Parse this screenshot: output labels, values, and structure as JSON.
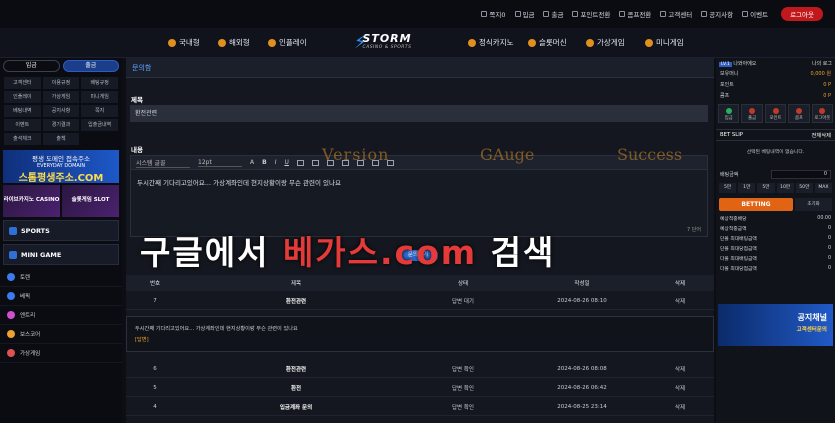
{
  "topbar": {
    "links": [
      "쪽지0",
      "입금",
      "출금",
      "포인트전환",
      "콤프전환",
      "고객센터",
      "공지사항",
      "이벤트"
    ],
    "logout": "로그아웃"
  },
  "nav": {
    "left": [
      "국내형",
      "해외형",
      "인플레이"
    ],
    "right": [
      "정식카지노",
      "슬롯머신",
      "가상게임",
      "미니게임"
    ],
    "logo": "STORM",
    "logo_sub": "CASINO & SPORTS"
  },
  "left": {
    "deposit": "입금",
    "withdraw": "출금",
    "menu": [
      "고객센터",
      "이용규정",
      "배팅규정",
      "인플레이",
      "가상게임",
      "미니게임",
      "베팅내역",
      "공지사항",
      "쪽지",
      "이벤트",
      "경기결과",
      "입출금내역",
      "출석체크",
      "출첵"
    ],
    "banner1_top": "평생 도메인 접속주소",
    "banner1_mid": "EVERYDAY DOMAIN",
    "banner1_big": "스톰평생주소.COM",
    "banner2": [
      "라이브카지노 CASINO",
      "슬롯게임 SLOT"
    ],
    "blocks": [
      "SPORTS",
      "MINI GAME"
    ],
    "items": [
      "토렌",
      "베픽",
      "엔트리",
      "보스코어",
      "가상게임"
    ]
  },
  "main": {
    "header": "문의함",
    "subject_label": "제목",
    "subject_value": "환전관련",
    "content_label": "내용",
    "font_select": "시스템 글꼴",
    "size_select": "12pt",
    "body_text": "두시간째 기다리고있어요... 가상계좌인데 현지상황이랑 무슨 관련이 있나요",
    "counter": "7 단어",
    "submit": "문의하기",
    "columns": [
      "번호",
      "제목",
      "상태",
      "작성일",
      "삭제"
    ],
    "rows": [
      [
        "7",
        "환전관련",
        "답변 대기",
        "2024-08-26 08:10",
        "삭제"
      ],
      [
        "6",
        "환전관련",
        "답변 확인",
        "2024-08-26 08:08",
        "삭제"
      ],
      [
        "5",
        "환전",
        "답변 확인",
        "2024-08-26 06:42",
        "삭제"
      ],
      [
        "4",
        "입금계좌 문의",
        "답변 확인",
        "2024-08-25 23:14",
        "삭제"
      ]
    ],
    "detail_text": "두시간째 기다리고있어요... 가상계좌인데 현지상황이랑 무슨 관련이 있나요",
    "detail_answer": "[답변]"
  },
  "watermark": {
    "w1": "Version",
    "w2": "GAuge",
    "w3": "Success",
    "big_pre": "구글에서 ",
    "big_red": "베가스.com",
    "big_post": " 검색"
  },
  "right": {
    "level": "LV.1",
    "user": "나와아에오",
    "logout_small": "나의",
    "logout_small2": "로그",
    "rows": [
      [
        "보유머니",
        "0,000 원"
      ],
      [
        "포인트",
        "0 P"
      ],
      [
        "콤프",
        "0 P"
      ]
    ],
    "quick": [
      "입금",
      "출금",
      "포인트",
      "콤프",
      "로그아웃"
    ],
    "betslip": "BET SLIP",
    "clear": "전체삭제",
    "empty": "선택된 베팅내역이 없습니다.",
    "amount_label": "배팅금액",
    "amount_value": "0",
    "chips": [
      "5만",
      "1만",
      "5만",
      "10만",
      "50만",
      "MAX"
    ],
    "bet": "BETTING",
    "reset": "초기화",
    "sums": [
      [
        "예상적중배당",
        "00.00"
      ],
      [
        "예상적중금액",
        "0"
      ],
      [
        "단폴 최대배팅금액",
        "0"
      ],
      [
        "단폴 최대당첨금액",
        "0"
      ],
      [
        "다폴 최대배팅금액",
        "0"
      ],
      [
        "다폴 최대당첨금액",
        "0"
      ]
    ],
    "notice_title": "공지채널",
    "notice_sub": "고객센터문의"
  }
}
